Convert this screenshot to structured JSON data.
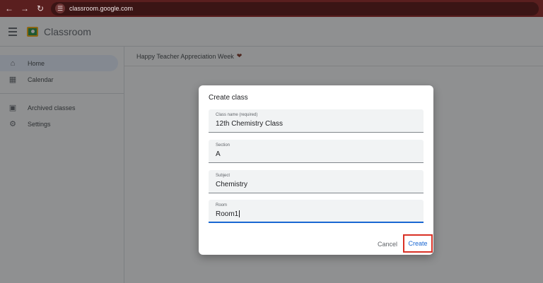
{
  "browser": {
    "url": "classroom.google.com"
  },
  "header": {
    "title": "Classroom"
  },
  "sidebar": {
    "items": [
      {
        "label": "Home",
        "icon": "home-icon"
      },
      {
        "label": "Calendar",
        "icon": "calendar-icon"
      },
      {
        "label": "Archived classes",
        "icon": "archive-icon"
      },
      {
        "label": "Settings",
        "icon": "gear-icon"
      }
    ]
  },
  "banner": {
    "text": "Happy Teacher Appreciation Week"
  },
  "dialog": {
    "title": "Create class",
    "fields": [
      {
        "label": "Class name (required)",
        "value": "12th Chemistry Class"
      },
      {
        "label": "Section",
        "value": "A"
      },
      {
        "label": "Subject",
        "value": "Chemistry"
      },
      {
        "label": "Room",
        "value": "Room1"
      }
    ],
    "cancel_label": "Cancel",
    "create_label": "Create"
  },
  "colors": {
    "chrome": "#5a1f1f",
    "accent": "#1967d2",
    "highlight": "#d93025"
  }
}
